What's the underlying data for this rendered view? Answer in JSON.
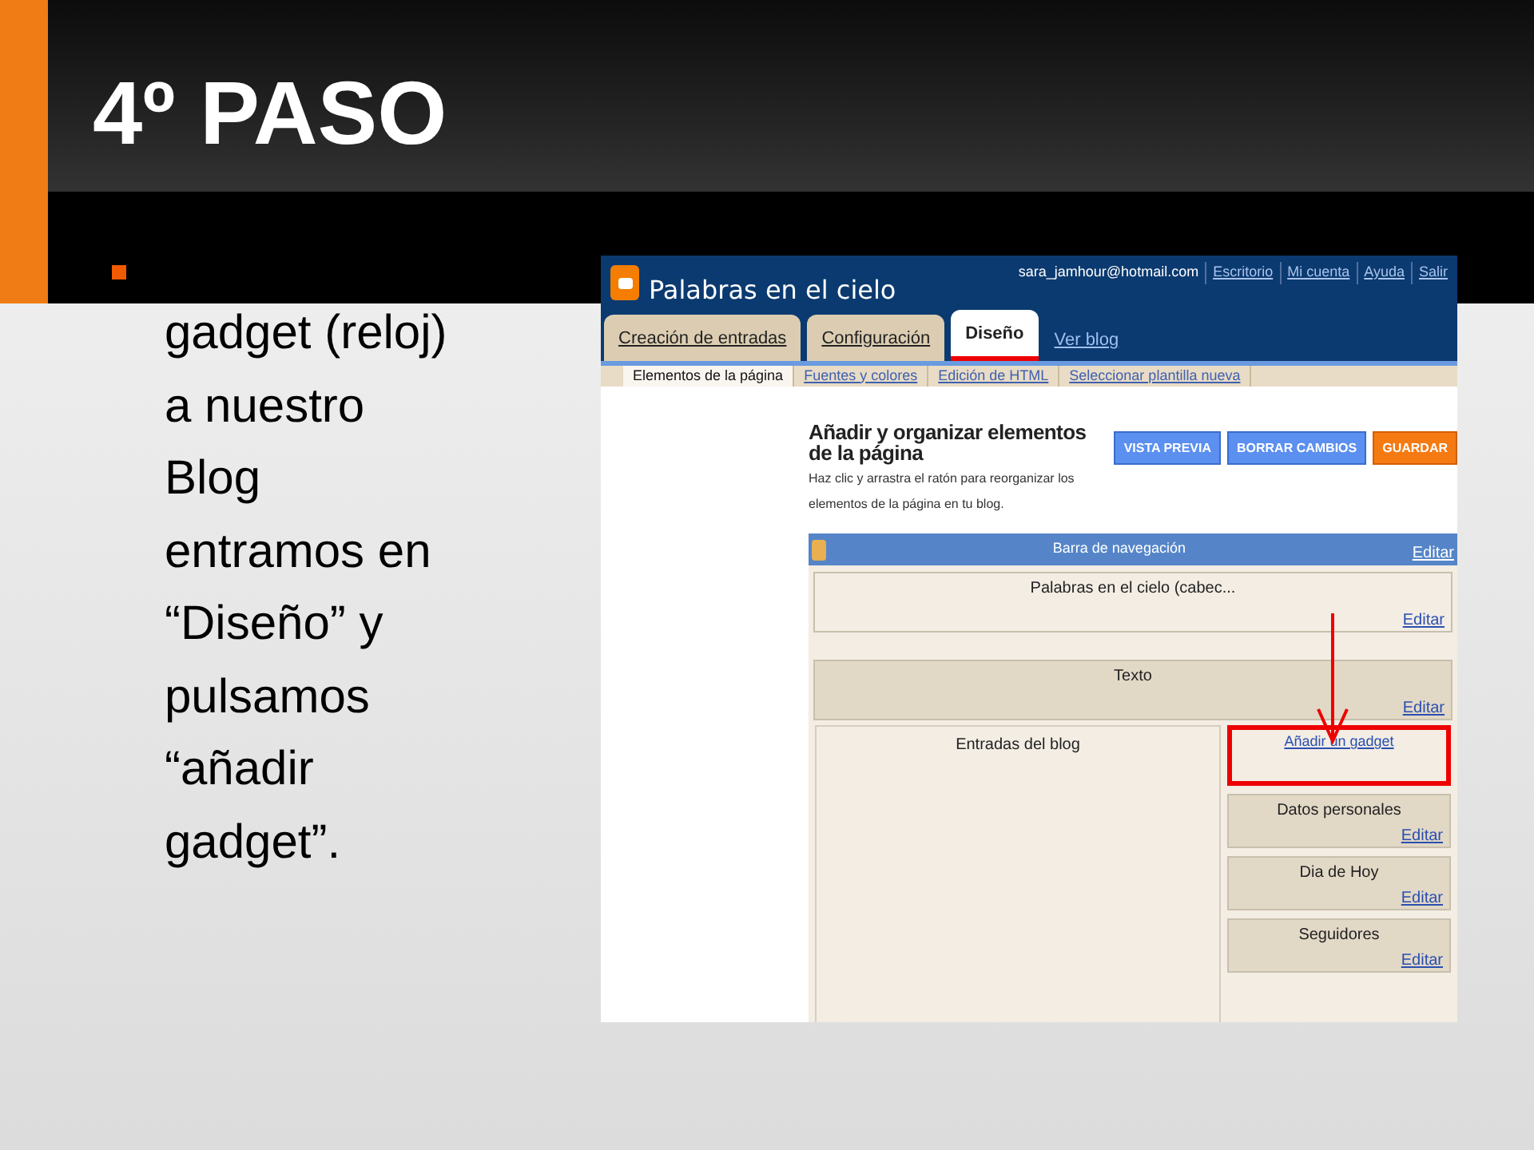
{
  "slide": {
    "title": "4º PASO",
    "bullet_lines": [
      "gadget (reloj)",
      "a nuestro",
      "Blog",
      "entramos en",
      "“Diseño” y",
      "pulsamos",
      "“añadir",
      "gadget”."
    ]
  },
  "screenshot": {
    "blog_title": "Palabras en el cielo",
    "user_email": "sara_jamhour@hotmail.com",
    "user_links": [
      "Escritorio",
      "Mi cuenta",
      "Ayuda",
      "Salir"
    ],
    "tabs": [
      {
        "label": "Creación de entradas",
        "selected": false
      },
      {
        "label": "Configuración",
        "selected": false
      },
      {
        "label": "Diseño",
        "selected": true
      }
    ],
    "view_blog_link": "Ver blog",
    "subtabs": [
      {
        "label": "Elementos de la página",
        "selected": true
      },
      {
        "label": "Fuentes y colores",
        "selected": false
      },
      {
        "label": "Edición de HTML",
        "selected": false
      },
      {
        "label": "Seleccionar plantilla nueva",
        "selected": false
      }
    ],
    "heading": "Añadir y organizar elementos de la página",
    "description": "Haz clic y arrastra el ratón para reorganizar los elementos de la página en tu blog.",
    "buttons": [
      {
        "label": "VISTA PREVIA",
        "kind": "preview"
      },
      {
        "label": "BORRAR CAMBIOS",
        "kind": "clear"
      },
      {
        "label": "GUARDAR",
        "kind": "save"
      }
    ],
    "navbar": {
      "title": "Barra de navegación",
      "edit": "Editar"
    },
    "header_widget": {
      "title": "Palabras en el cielo (cabec...",
      "edit": "Editar"
    },
    "text_widget": {
      "title": "Texto",
      "edit": "Editar"
    },
    "main_column": {
      "title": "Entradas del blog"
    },
    "add_gadget_link": "Añadir un gadget",
    "sidebar_widgets": [
      {
        "title": "Datos personales",
        "edit": "Editar"
      },
      {
        "title": "Dia de Hoy",
        "edit": "Editar"
      },
      {
        "title": "Seguidores",
        "edit": "Editar"
      }
    ]
  }
}
